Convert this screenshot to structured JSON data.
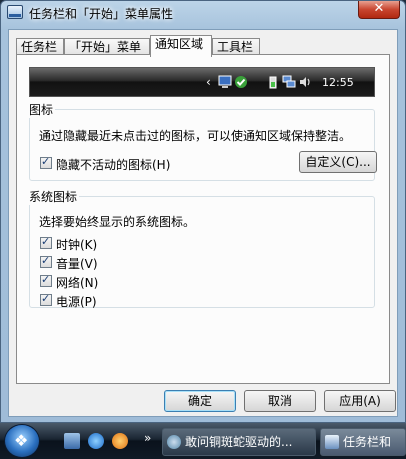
{
  "window": {
    "title": "任务栏和「开始」菜单属性",
    "close_glyph": "✕"
  },
  "tabs": [
    {
      "label": "任务栏",
      "active": false
    },
    {
      "label": "「开始」菜单",
      "active": false
    },
    {
      "label": "通知区域",
      "active": true
    },
    {
      "label": "工具栏",
      "active": false
    }
  ],
  "preview": {
    "arrow": "‹",
    "time": "12:55"
  },
  "icons_group": {
    "legend": "图标",
    "description": "通过隐藏最近未点击过的图标，可以使通知区域保持整洁。",
    "hide_inactive": {
      "label": "隐藏不活动的图标(H)",
      "checked": true
    },
    "customize_button": "自定义(C)..."
  },
  "system_group": {
    "legend": "系统图标",
    "description": "选择要始终显示的系统图标。",
    "items": [
      {
        "label": "时钟(K)",
        "checked": true
      },
      {
        "label": "音量(V)",
        "checked": true
      },
      {
        "label": "网络(N)",
        "checked": true
      },
      {
        "label": "电源(P)",
        "checked": true
      }
    ]
  },
  "buttons": {
    "ok": "确定",
    "cancel": "取消",
    "apply": "应用(A)"
  },
  "os_taskbar": {
    "more": "»",
    "items": [
      {
        "label": "敢问铜斑蛇驱动的...",
        "active": false
      },
      {
        "label": "任务栏和",
        "active": true
      }
    ]
  },
  "colors": {
    "accent": "#3c7fb1",
    "close": "#c8452f"
  }
}
